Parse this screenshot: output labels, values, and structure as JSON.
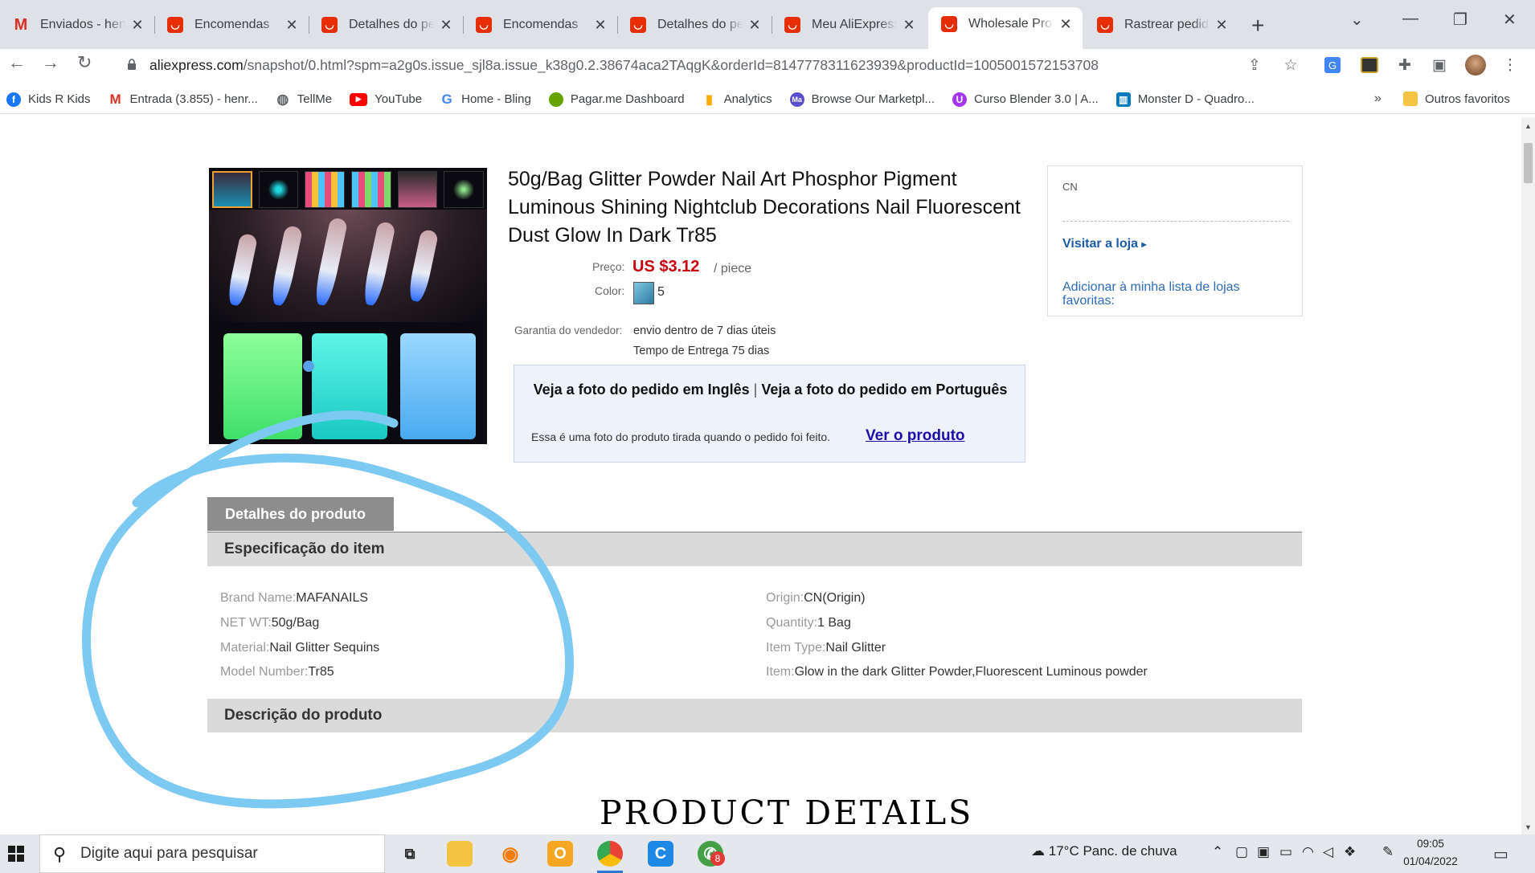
{
  "browser": {
    "tabs": [
      {
        "title": "Enviados - henr",
        "favicon": "gmail-icon"
      },
      {
        "title": "Encomendas",
        "favicon": "aliexpress-icon"
      },
      {
        "title": "Detalhes do pe",
        "favicon": "aliexpress-icon"
      },
      {
        "title": "Encomendas",
        "favicon": "aliexpress-icon"
      },
      {
        "title": "Detalhes do pe",
        "favicon": "aliexpress-icon"
      },
      {
        "title": "Meu AliExpress",
        "favicon": "aliexpress-icon"
      },
      {
        "title": "Wholesale Prod",
        "favicon": "aliexpress-icon",
        "active": true
      },
      {
        "title": "Rastrear pedido",
        "favicon": "aliexpress-icon"
      }
    ],
    "url_host": "aliexpress.com",
    "url_path": "/snapshot/0.html?spm=a2g0s.issue_sjl8a.issue_k38g0.2.38674aca2TAqgK&orderId=8147778311623939&productId=1005001572153708",
    "bookmarks": [
      {
        "label": "Kids R Kids",
        "icon": "facebook-icon",
        "color": "#1877f2"
      },
      {
        "label": "Entrada (3.855) - henr...",
        "icon": "gmail-icon",
        "color": "#d93025"
      },
      {
        "label": "TellMe",
        "icon": "globe-icon",
        "color": "#5f6368"
      },
      {
        "label": "YouTube",
        "icon": "youtube-icon",
        "color": "#ff0000"
      },
      {
        "label": "Home - Bling",
        "icon": "google-icon",
        "color": "#4285f4"
      },
      {
        "label": "Pagar.me Dashboard",
        "icon": "pagarme-icon",
        "color": "#65a300"
      },
      {
        "label": "Analytics",
        "icon": "analytics-icon",
        "color": "#f9ab00"
      },
      {
        "label": "Browse Our Marketpl...",
        "icon": "marketplace-icon",
        "color": "#5a4fcf"
      },
      {
        "label": "Curso Blender 3.0 | A...",
        "icon": "udemy-icon",
        "color": "#a435f0"
      },
      {
        "label": "Monster D - Quadro...",
        "icon": "trello-icon",
        "color": "#0079bf"
      }
    ],
    "bookmarks_more": "»",
    "other_bookmarks": "Outros favoritos"
  },
  "product": {
    "title": "50g/Bag Glitter Powder Nail Art Phosphor Pigment Luminous Shining Nightclub Decorations Nail Fluorescent Dust Glow In Dark Tr85",
    "price_label": "Preço:",
    "price": "US $3.12",
    "price_unit": "/ piece",
    "color_label": "Color:",
    "color_value": "5",
    "guarantee_label": "Garantia do vendedor:",
    "guarantee_1": "envio dentro de 7 dias úteis",
    "guarantee_2": "Tempo de Entrega 75 dias"
  },
  "snapshot": {
    "link_en": "Veja a foto do pedido em Inglês",
    "divider": "|",
    "link_pt": "Veja a foto do pedido em Português",
    "note": "Essa é uma foto do produto tirada quando o pedido foi feito.",
    "view_link": "Ver o produto"
  },
  "store": {
    "country": "CN",
    "visit": "Visitar a loja",
    "visit_arrow": "▸",
    "add_fav": "Adicionar à minha lista de lojas favoritas:"
  },
  "details": {
    "tab": "Detalhes do produto",
    "spec_header": "Especificação do item",
    "left_specs": [
      {
        "k": "Brand Name:",
        "v": "MAFANAILS"
      },
      {
        "k": "NET WT:",
        "v": "50g/Bag"
      },
      {
        "k": "Material:",
        "v": "Nail Glitter Sequins"
      },
      {
        "k": "Model Number:",
        "v": "Tr85"
      }
    ],
    "right_specs": [
      {
        "k": "Origin:",
        "v": "CN(Origin)"
      },
      {
        "k": "Quantity:",
        "v": "1 Bag"
      },
      {
        "k": "Item Type:",
        "v": "Nail Glitter"
      },
      {
        "k": "Item:",
        "v": "Glow in the dark Glitter Powder,Fluorescent Luminous powder"
      }
    ],
    "desc_header": "Descrição do produto",
    "banner": "PRODUCT DETAILS"
  },
  "taskbar": {
    "search_placeholder": "Digite aqui para pesquisar",
    "badge_count": "8",
    "weather": "17°C  Panc. de chuva",
    "time": "09:05",
    "date": "01/04/2022"
  },
  "colors": {
    "price": "#c7000b",
    "link": "#1a0dab",
    "annotation_circle": "#7cc9f2",
    "aliexpress": "#e62e04"
  }
}
